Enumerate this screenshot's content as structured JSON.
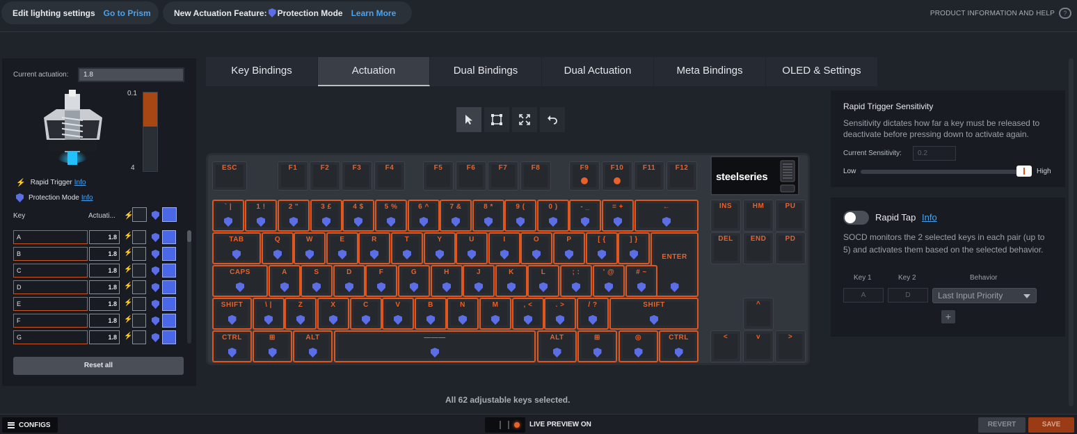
{
  "topbar": {
    "lighting_label": "Edit lighting settings",
    "lighting_link": "Go to Prism",
    "feature_label": "New Actuation Feature:",
    "feature_name": "Protection Mode",
    "feature_link": "Learn More",
    "product_help": "PRODUCT INFORMATION AND HELP"
  },
  "left_panel": {
    "current_actuation_label": "Current actuation:",
    "current_actuation_value": "1.8",
    "gauge_top": "0.1",
    "gauge_bottom": "4",
    "gauge_fill_fraction": 0.43,
    "rapid_trigger": "Rapid Trigger",
    "rapid_trigger_info": "Info",
    "protection_mode": "Protection Mode",
    "protection_mode_info": "Info",
    "col_key": "Key",
    "col_actuation": "Actuati...",
    "rows": [
      {
        "key": "A",
        "value": "1.8"
      },
      {
        "key": "B",
        "value": "1.8"
      },
      {
        "key": "C",
        "value": "1.8"
      },
      {
        "key": "D",
        "value": "1.8"
      },
      {
        "key": "E",
        "value": "1.8"
      },
      {
        "key": "F",
        "value": "1.8"
      },
      {
        "key": "G",
        "value": "1.8"
      }
    ],
    "reset_all": "Reset all"
  },
  "tabs": [
    "Key Bindings",
    "Actuation",
    "Dual Bindings",
    "Dual Actuation",
    "Meta Bindings",
    "OLED & Settings"
  ],
  "keyboard": {
    "oled_logo": "steelseries",
    "keys": {
      "esc": "ESC",
      "f1": "F1",
      "f2": "F2",
      "f3": "F3",
      "f4": "F4",
      "f5": "F5",
      "f6": "F6",
      "f7": "F7",
      "f8": "F8",
      "f9": "F9",
      "f10": "F10",
      "f11": "F11",
      "f12": "F12",
      "grave": "` |",
      "n1": "1 !",
      "n2": "2 \"",
      "n3": "3 £",
      "n4": "4 $",
      "n5": "5 %",
      "n6": "6 ^",
      "n7": "7 &",
      "n8": "8 *",
      "n9": "9 (",
      "n0": "0 )",
      "minus": "- _",
      "equal": "= +",
      "bksp": "←",
      "tab": "TAB",
      "q": "Q",
      "w": "W",
      "e": "E",
      "r": "R",
      "t": "T",
      "y": "Y",
      "u": "U",
      "i": "I",
      "o": "O",
      "p": "P",
      "lbr": "[ {",
      "rbr": "] }",
      "enter": "ENTER",
      "caps": "CAPS",
      "a": "A",
      "s": "S",
      "d": "D",
      "f": "F",
      "g": "G",
      "h": "H",
      "j": "J",
      "k": "K",
      "l": "L",
      "semi": "; :",
      "quote": "' @",
      "hash": "# ~",
      "lshift": "SHIFT",
      "bslash": "\\ |",
      "z": "Z",
      "x": "X",
      "c": "C",
      "v": "V",
      "b": "B",
      "n": "N",
      "m": "M",
      "comma": ", <",
      "period": ". >",
      "slash": "/ ?",
      "rshift": "SHIFT",
      "lctrl": "CTRL",
      "lwin": "⊞",
      "lalt": "ALT",
      "space": "———",
      "ralt": "ALT",
      "rwin": "⊞",
      "menu": "◎",
      "rctrl": "CTRL",
      "ins": "INS",
      "hm": "HM",
      "pu": "PU",
      "del": "DEL",
      "end": "END",
      "pd": "PD",
      "up": "^",
      "left": "<",
      "down": "v",
      "right": ">"
    }
  },
  "status": "All 62 adjustable keys selected.",
  "rapid_trigger_panel": {
    "title": "Rapid Trigger Sensitivity",
    "description": "Sensitivity dictates how far a key must be released to deactivate before pressing down to activate again.",
    "current_label": "Current Sensitivity:",
    "current_placeholder": "0.2",
    "low": "Low",
    "high": "High",
    "slider_fraction": 0.96
  },
  "rapid_tap_panel": {
    "label": "Rapid Tap",
    "info": "Info",
    "description": "SOCD monitors the 2 selected keys in each pair (up to 5) and activates them based on the selected behavior.",
    "col_key1": "Key 1",
    "col_key2": "Key 2",
    "col_behavior": "Behavior",
    "key1": "A",
    "key2": "D",
    "behavior": "Last Input Priority",
    "add": "+"
  },
  "bottombar": {
    "configs": "CONFIGS",
    "live_preview": "LIVE PREVIEW ON",
    "revert": "REVERT",
    "save": "SAVE"
  },
  "colors": {
    "accent_orange": "#e0561d",
    "shield_blue": "#5b6ee6",
    "link_blue": "#4aa3f0"
  }
}
